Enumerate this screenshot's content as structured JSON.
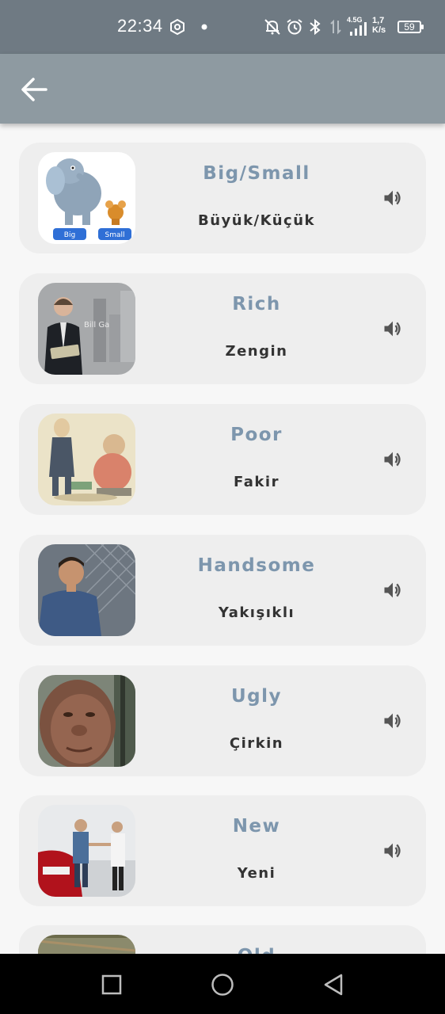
{
  "status_bar": {
    "time": "22:34",
    "network": "4.5G",
    "speed_value": "1,7",
    "speed_unit": "K/s",
    "battery": "59",
    "icons": [
      "settings-hex-icon",
      "dot-icon",
      "bell-off-icon",
      "alarm-icon",
      "bluetooth-icon",
      "data-arrows-icon",
      "signal-icon",
      "battery-icon"
    ]
  },
  "app_bar": {
    "back_icon": "arrow-left-icon"
  },
  "colors": {
    "word": "#7d96ad",
    "translation": "#333333",
    "card": "#eeeeee",
    "app_bar": "#8e9aa1",
    "status_bar": "#6f7a83"
  },
  "cards": [
    {
      "word": "Big/Small",
      "translation": "Büyük/Küçük",
      "image": "elephant-mouse-cartoon",
      "badges": [
        "Big",
        "Small"
      ]
    },
    {
      "word": "Rich",
      "translation": "Zengin",
      "image": "businessman-photo",
      "image_caption": "Bill Ga"
    },
    {
      "word": "Poor",
      "translation": "Fakir",
      "image": "rich-poor-cartoon"
    },
    {
      "word": "Handsome",
      "translation": "Yakışıklı",
      "image": "man-fence-photo"
    },
    {
      "word": "Ugly",
      "translation": "Çirkin",
      "image": "caveman-photo"
    },
    {
      "word": "New",
      "translation": "Yeni",
      "image": "car-showroom-photo"
    },
    {
      "word": "Old",
      "translation": "",
      "image": "old-photo"
    }
  ],
  "nav_bar": {
    "icons": [
      "recents-square-icon",
      "home-circle-icon",
      "back-triangle-icon"
    ]
  }
}
